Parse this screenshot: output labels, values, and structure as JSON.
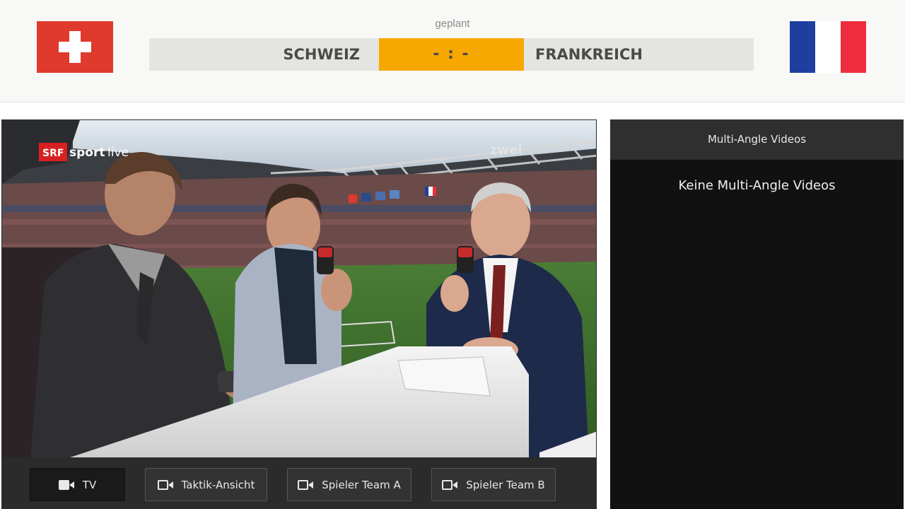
{
  "match": {
    "status": "geplant",
    "home_team": "SCHWEIZ",
    "away_team": "FRANKREICH",
    "score": "- : -",
    "score_color": "#f7a800"
  },
  "flags": {
    "home": {
      "icon": "swiss-flag-icon",
      "colors": [
        "#e03a2e",
        "#ffffff"
      ]
    },
    "away": {
      "icon": "french-flag-icon",
      "colors": [
        "#1f3fa0",
        "#ffffff",
        "#ee2e3f"
      ]
    }
  },
  "video": {
    "overlay_logo_srf": "SRF",
    "overlay_logo_sport": "sport",
    "overlay_logo_live": "live",
    "overlay_logo_zwei": "zwei",
    "description": "SRF studio commentators at stadium"
  },
  "camera_buttons": [
    {
      "label": "TV",
      "icon": "video-camera-icon",
      "active": true
    },
    {
      "label": "Taktik-Ansicht",
      "icon": "video-camera-icon",
      "active": false
    },
    {
      "label": "Spieler Team A",
      "icon": "video-camera-icon",
      "active": false
    },
    {
      "label": "Spieler Team B",
      "icon": "video-camera-icon",
      "active": false
    }
  ],
  "multi_angle": {
    "title": "Multi-Angle Videos",
    "empty_text": "Keine Multi-Angle Videos"
  }
}
